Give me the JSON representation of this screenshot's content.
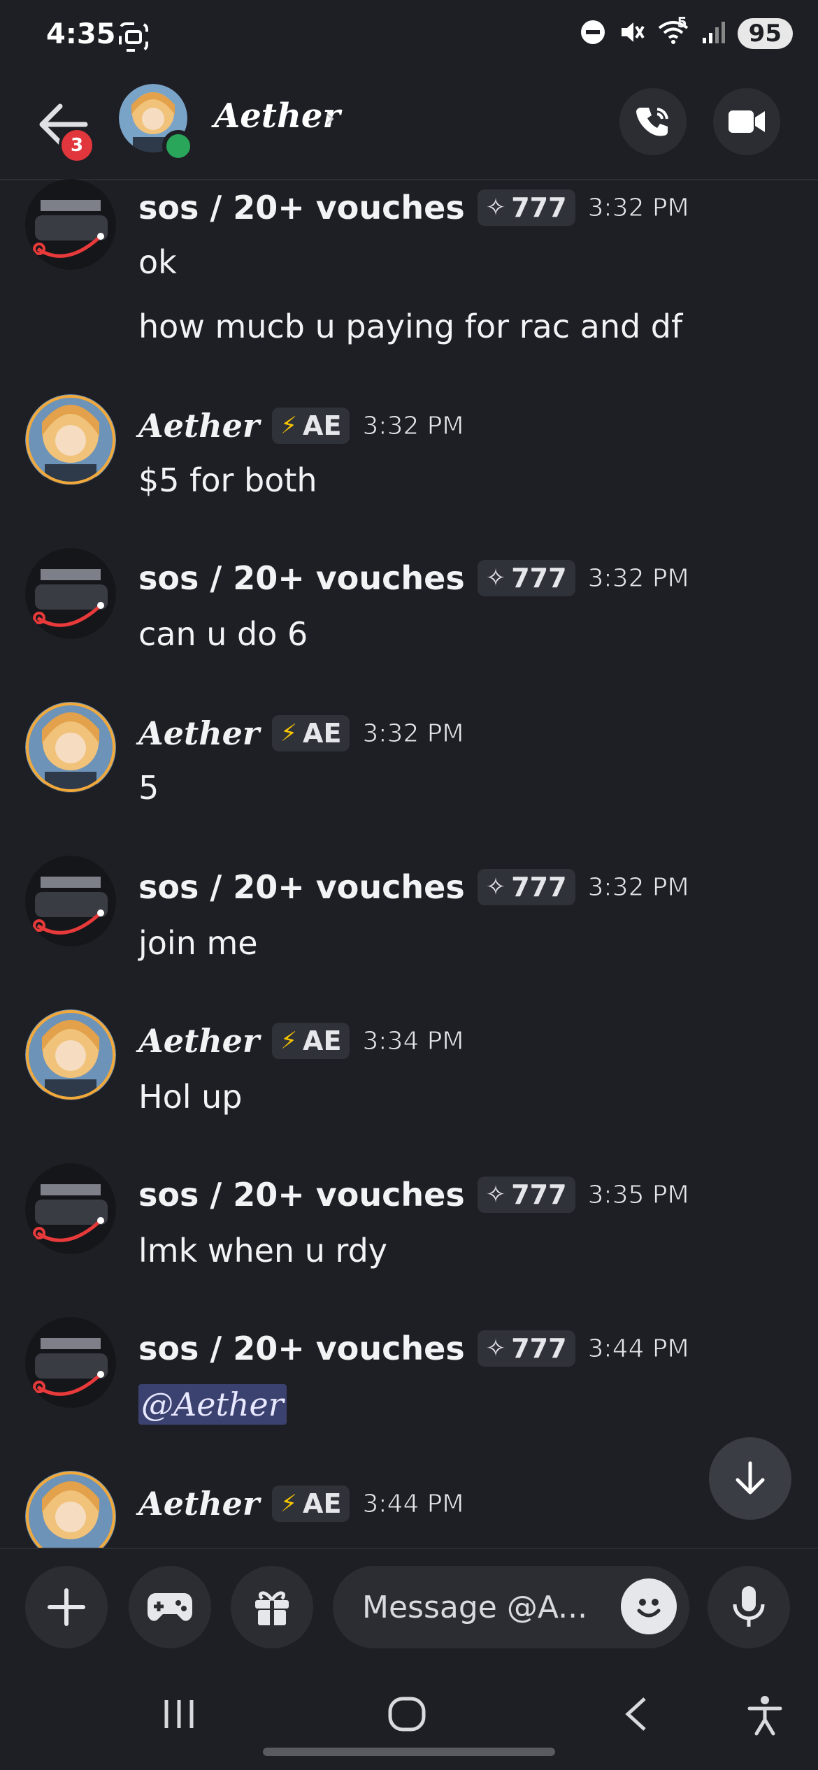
{
  "status_bar": {
    "time": "4:35",
    "battery": "95",
    "wifi_label": "5"
  },
  "header": {
    "name": "Aether",
    "unread_count": "3"
  },
  "messages": [
    {
      "user": "sos / 20+ vouches",
      "tag": "777",
      "time": "3:32 PM",
      "lines": [
        "ok",
        "how mucb u paying for rac and df"
      ]
    },
    {
      "user": "Aether",
      "tag": "AE",
      "time": "3:32 PM",
      "lines": [
        "$5 for both"
      ]
    },
    {
      "user": "sos / 20+ vouches",
      "tag": "777",
      "time": "3:32 PM",
      "lines": [
        "can u do 6"
      ]
    },
    {
      "user": "Aether",
      "tag": "AE",
      "time": "3:32 PM",
      "lines": [
        "5"
      ]
    },
    {
      "user": "sos / 20+ vouches",
      "tag": "777",
      "time": "3:32 PM",
      "lines": [
        "join me"
      ]
    },
    {
      "user": "Aether",
      "tag": "AE",
      "time": "3:34 PM",
      "lines": [
        "Hol up"
      ]
    },
    {
      "user": "sos / 20+ vouches",
      "tag": "777",
      "time": "3:35 PM",
      "lines": [
        "lmk when u rdy"
      ]
    },
    {
      "user": "sos / 20+ vouches",
      "tag": "777",
      "time": "3:44 PM",
      "lines": [
        "@Aether"
      ]
    },
    {
      "user": "Aether",
      "tag": "AE",
      "time": "3:44 PM",
      "lines": []
    }
  ],
  "composer": {
    "placeholder": "Message @A..."
  },
  "colors": {
    "background": "#1e1f24",
    "online": "#2aa65a",
    "badge": "#e0363c",
    "mention_bg": "#3c4270"
  }
}
